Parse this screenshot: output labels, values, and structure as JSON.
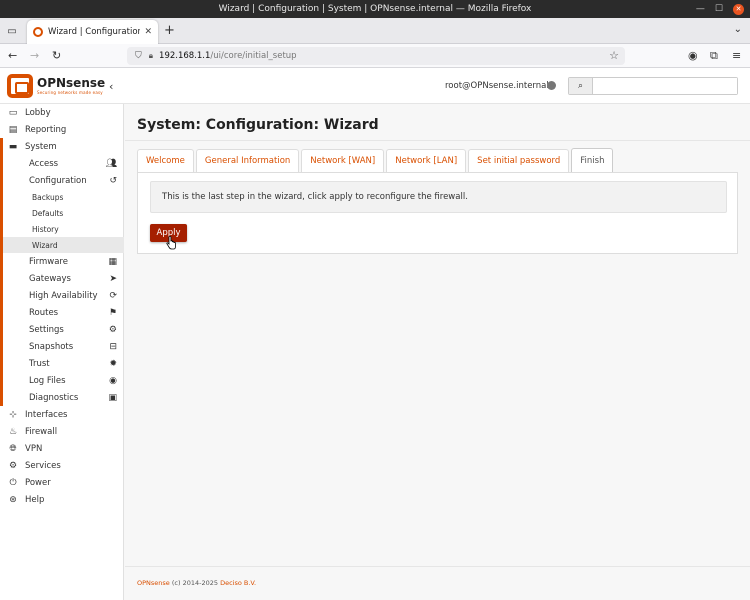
{
  "window": {
    "title": "Wizard | Configuration | System | OPNsense.internal — Mozilla Firefox"
  },
  "browser": {
    "tab_title": "Wizard | Configuration | Sy",
    "url_host": "192.168.1.1",
    "url_path": "/ui/core/initial_setup"
  },
  "header": {
    "brand": "OPNsense",
    "tagline": "Securing networks made easy",
    "user": "root@OPNsense.internal",
    "search_placeholder": ""
  },
  "sidebar": {
    "lobby": "Lobby",
    "reporting": "Reporting",
    "system": "System",
    "access": "Access",
    "configuration": "Configuration",
    "backups": "Backups",
    "defaults": "Defaults",
    "history": "History",
    "wizard": "Wizard",
    "firmware": "Firmware",
    "gateways": "Gateways",
    "high_availability": "High Availability",
    "routes": "Routes",
    "settings": "Settings",
    "snapshots": "Snapshots",
    "trust": "Trust",
    "log_files": "Log Files",
    "diagnostics": "Diagnostics",
    "interfaces": "Interfaces",
    "firewall": "Firewall",
    "vpn": "VPN",
    "services": "Services",
    "power": "Power",
    "help": "Help"
  },
  "main": {
    "title": "System: Configuration: Wizard",
    "tabs": [
      "Welcome",
      "General Information",
      "Network [WAN]",
      "Network [LAN]",
      "Set initial password",
      "Finish"
    ],
    "active_tab": "Finish",
    "message": "This is the last step in the wizard, click apply to reconfigure the firewall.",
    "apply_label": "Apply"
  },
  "footer": {
    "brand": "OPNsense",
    "copyright": " (c) 2014-2025 ",
    "company": "Deciso B.V."
  },
  "colors": {
    "accent": "#d94f00",
    "button": "#a51f00"
  }
}
